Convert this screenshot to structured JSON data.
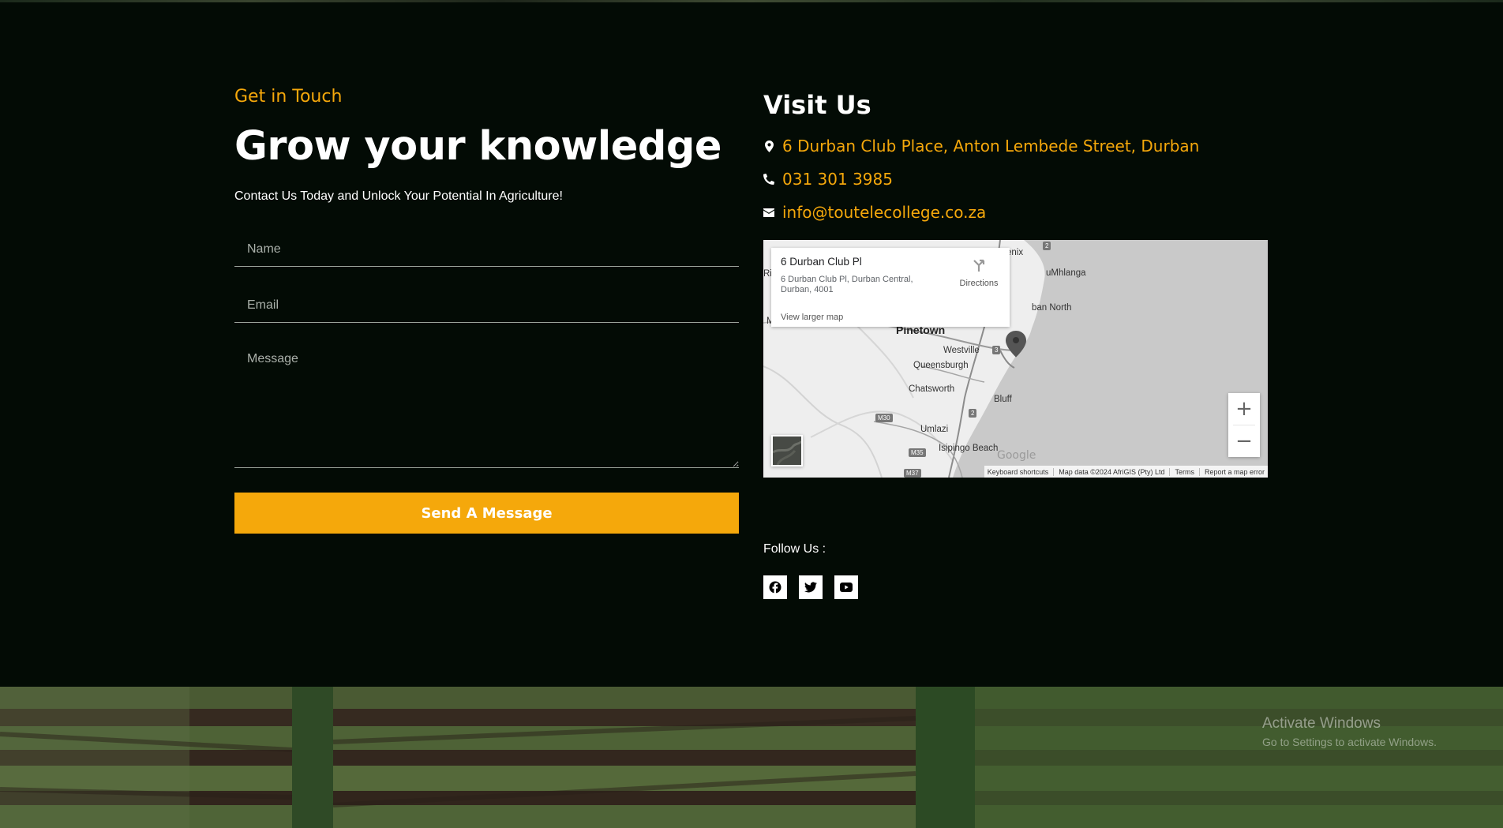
{
  "contact": {
    "eyebrow": "Get in Touch",
    "heading": "Grow your knowledge",
    "subtitle": "Contact Us Today and Unlock Your Potential In Agriculture!",
    "name_placeholder": "Name",
    "email_placeholder": "Email",
    "message_placeholder": "Message",
    "send_label": "Send A Message"
  },
  "visit": {
    "title": "Visit Us",
    "address": "6 Durban Club Place, Anton Lembede Street, Durban",
    "phone": "031 301 3985",
    "email": "info@toutelecollege.co.za",
    "icons": {
      "address": "map-pin-icon",
      "phone": "phone-icon",
      "email": "envelope-icon"
    }
  },
  "map": {
    "card_title": "6 Durban Club Pl",
    "card_address": "6 Durban Club Pl, Durban Central, Durban, 4001",
    "directions_label": "Directions",
    "larger_map_label": "View larger map",
    "places": [
      "enix",
      "uMhlanga",
      "ban North",
      "Pinetown",
      "Westville",
      "Queensburgh",
      "Chatsworth",
      "Bluff",
      "Umlazi",
      "Isipingo Beach",
      "Ri",
      "M"
    ],
    "routes": [
      "2",
      "3",
      "2",
      "M30",
      "M35",
      "M37"
    ],
    "logo_text": "Google",
    "attribution": {
      "keyboard": "Keyboard shortcuts",
      "data": "Map data ©2024 AfriGIS (Pty) Ltd",
      "terms": "Terms",
      "report": "Report a map error"
    },
    "zoom_in": "+",
    "zoom_out": "−"
  },
  "follow": {
    "label": "Follow Us :",
    "networks": [
      "facebook-icon",
      "twitter-icon",
      "youtube-icon"
    ]
  },
  "watermark": {
    "title": "Activate Windows",
    "subtitle": "Go to Settings to activate Windows."
  },
  "colors": {
    "accent": "#f5a80b",
    "background": "#030b05",
    "text": "#ffffff"
  }
}
